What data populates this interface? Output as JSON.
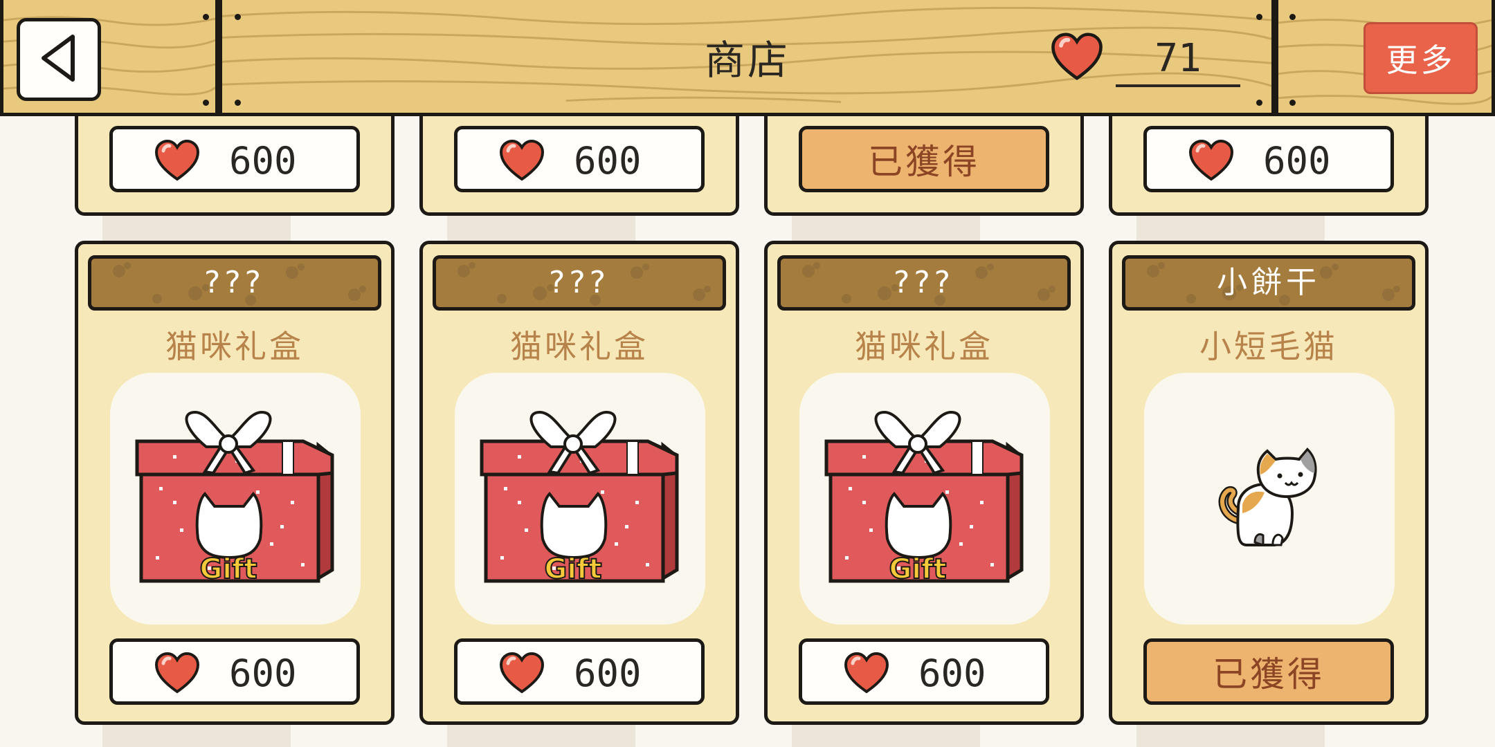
{
  "header": {
    "back_icon": "back-triangle-icon",
    "title": "商店",
    "heart_icon": "heart-icon",
    "heart_count": "71",
    "more_label": "更多"
  },
  "colors": {
    "wood": "#e8c97e",
    "card": "#f6e8b8",
    "heart": "#e75a45",
    "more_button": "#e9634b",
    "owned_button": "#edb470",
    "name_bar": "#a47c3d"
  },
  "top_row": [
    {
      "type": "price",
      "price": "600"
    },
    {
      "type": "price",
      "price": "600"
    },
    {
      "type": "owned",
      "label": "已獲得"
    },
    {
      "type": "price",
      "price": "600"
    }
  ],
  "items": [
    {
      "badge": "???",
      "name": "猫咪礼盒",
      "image": "gift-box-icon",
      "type": "price",
      "price": "600"
    },
    {
      "badge": "???",
      "name": "猫咪礼盒",
      "image": "gift-box-icon",
      "type": "price",
      "price": "600"
    },
    {
      "badge": "???",
      "name": "猫咪礼盒",
      "image": "gift-box-icon",
      "type": "price",
      "price": "600"
    },
    {
      "badge": "小餅干",
      "name": "小短毛猫",
      "image": "calico-cat-icon",
      "type": "owned",
      "label": "已獲得"
    }
  ],
  "gift_text": "Gift"
}
